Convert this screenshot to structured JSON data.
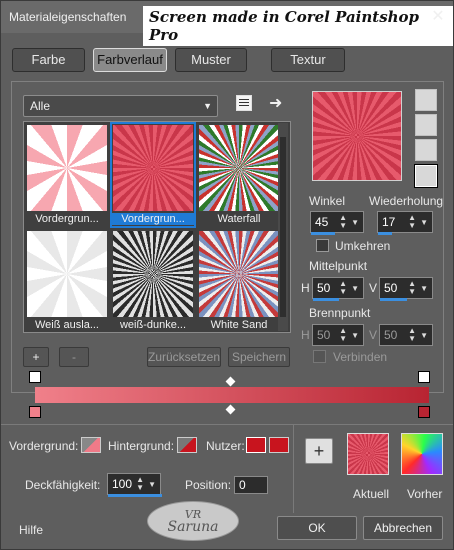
{
  "window": {
    "title": "Materialeigenschaften",
    "banner": "Screen made in Corel Paintshop Pro",
    "close": "✕"
  },
  "tabs": [
    {
      "label": "Farbe",
      "selected": false
    },
    {
      "label": "Farbverlauf",
      "selected": true
    },
    {
      "label": "Muster",
      "selected": false
    },
    {
      "label": "Textur",
      "selected": false
    }
  ],
  "category": {
    "value": "Alle"
  },
  "gradients": [
    {
      "label": "Vordergrun...",
      "selected": false
    },
    {
      "label": "Vordergrun...",
      "selected": true
    },
    {
      "label": "Waterfall",
      "selected": false
    },
    {
      "label": "Weiß ausla...",
      "selected": false
    },
    {
      "label": "weiß-dunke...",
      "selected": false
    },
    {
      "label": "White Sand",
      "selected": false
    }
  ],
  "gallery_buttons": {
    "add": "+",
    "remove": "-",
    "reset": "Zurücksetzen",
    "save": "Speichern"
  },
  "props": {
    "angle_label": "Winkel",
    "angle": "45",
    "repeat_label": "Wiederholung",
    "repeat": "17",
    "invert_label": "Umkehren",
    "center_label": "Mittelpunkt",
    "center_h": "50",
    "center_v": "50",
    "focal_label": "Brennpunkt",
    "focal_h": "50",
    "focal_v": "50",
    "link_label": "Verbinden",
    "h": "H",
    "v": "V"
  },
  "editor": {
    "fg_label": "Vordergrund:",
    "bg_label": "Hintergrund:",
    "user_label": "Nutzer:",
    "opacity_label": "Deckfähigkeit:",
    "opacity": "100",
    "position_label": "Position:",
    "position": "0",
    "start_color": "#f0808a",
    "end_color": "#b82432",
    "user_color": "#c8141e"
  },
  "compare": {
    "plus": "+",
    "current": "Aktuell",
    "previous": "Vorher"
  },
  "footer": {
    "help": "Hilfe",
    "ok": "OK",
    "cancel": "Abbrechen"
  },
  "watermark": {
    "line1": "VR",
    "line2": "Saruna"
  }
}
